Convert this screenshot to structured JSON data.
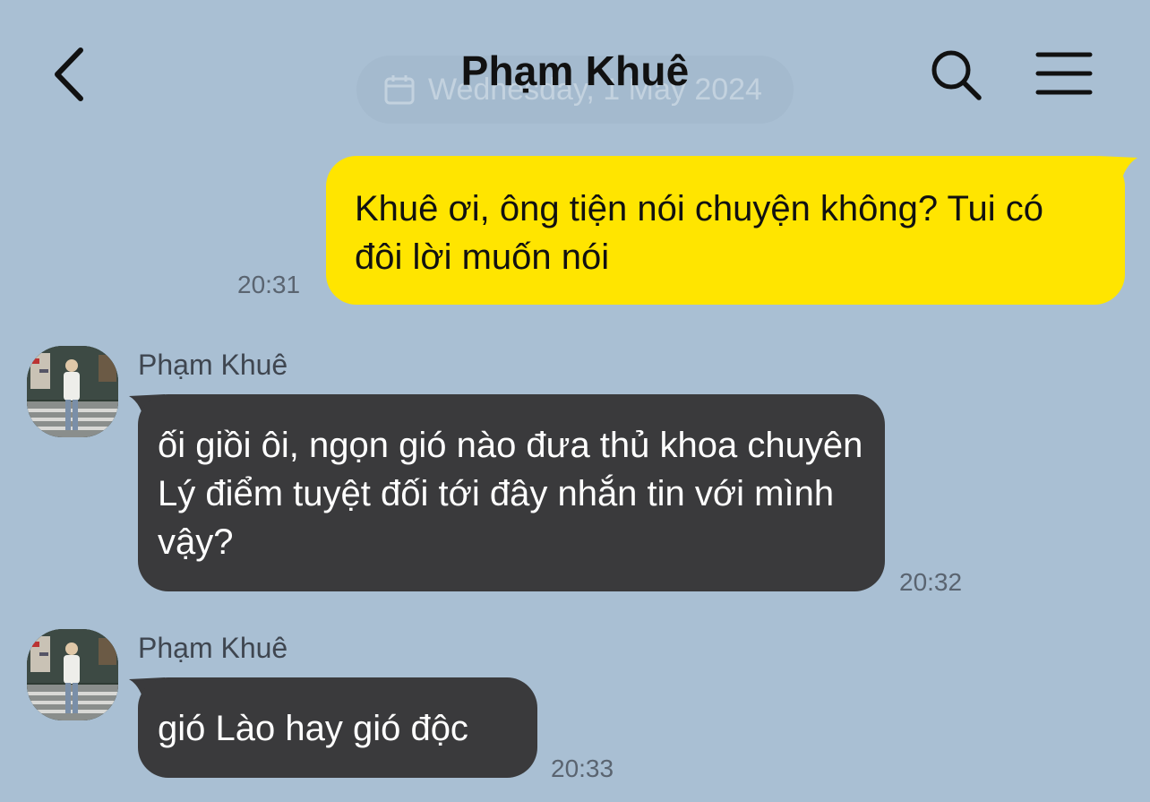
{
  "header": {
    "title": "Phạm Khuê",
    "date_banner": "Wednesday, 1 May 2024",
    "back_icon": "chevron-left-icon",
    "search_icon": "search-icon",
    "menu_icon": "hamburger-menu-icon"
  },
  "colors": {
    "background": "#a9bfd3",
    "sent_bubble": "#ffe500",
    "received_bubble": "#3a3a3c"
  },
  "messages": [
    {
      "direction": "outgoing",
      "text": "Khuê ơi, ông tiện nói chuyện không?  Tui có đôi lời muốn nói",
      "time": "20:31"
    },
    {
      "direction": "incoming",
      "sender": "Phạm Khuê",
      "text": "ối giồi ôi, ngọn gió nào đưa thủ khoa chuyên Lý điểm tuyệt đối tới đây nhắn tin với mình vậy?",
      "time": "20:32"
    },
    {
      "direction": "incoming",
      "sender": "Phạm Khuê",
      "text": "gió Lào hay gió độc",
      "time": "20:33"
    }
  ]
}
